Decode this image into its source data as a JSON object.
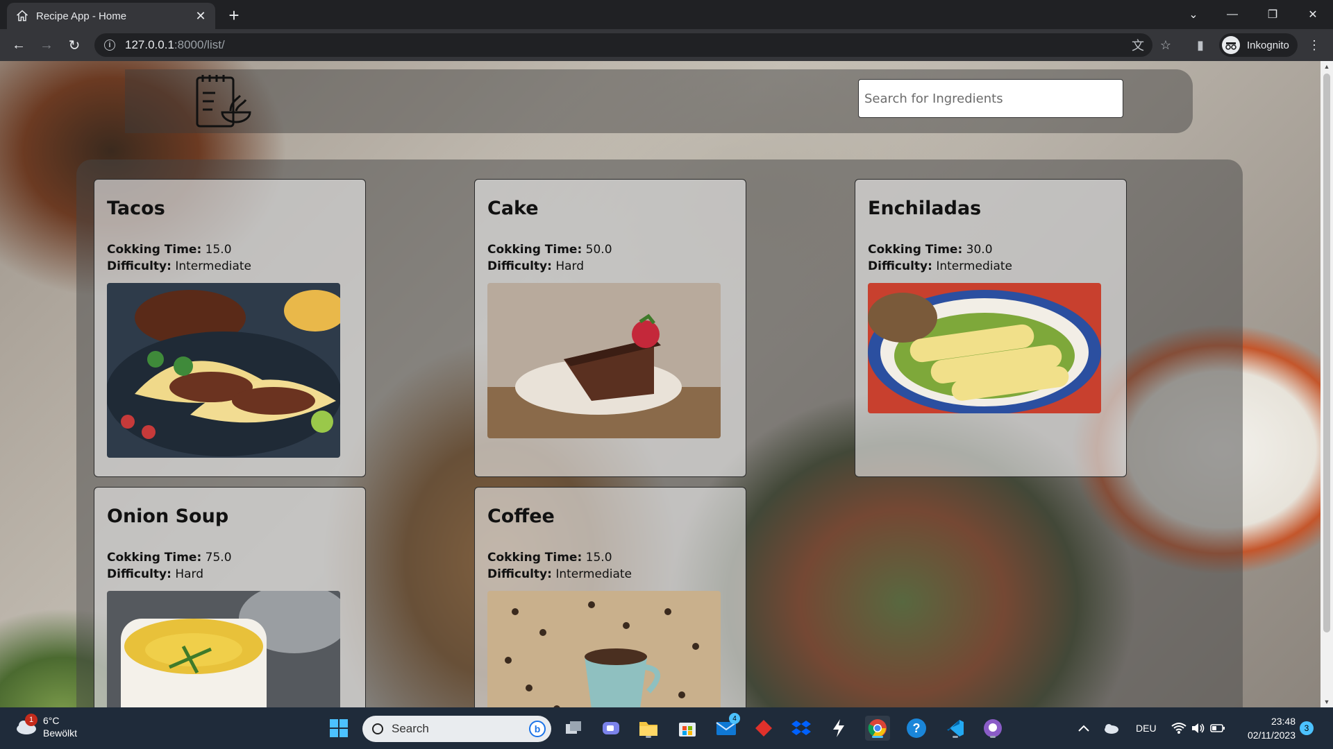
{
  "browser": {
    "tab_title": "Recipe App - Home",
    "url_host": "127.0.0.1",
    "url_path": ":8000/list/",
    "profile_label": "Inkognito"
  },
  "page": {
    "search_placeholder": "Search for Ingredients",
    "cooking_label": "Cokking Time:",
    "difficulty_label": "Difficulty:",
    "recipes": [
      {
        "name": "Tacos",
        "cooking_time": "15.0",
        "difficulty": "Intermediate"
      },
      {
        "name": "Cake",
        "cooking_time": "50.0",
        "difficulty": "Hard"
      },
      {
        "name": "Enchiladas",
        "cooking_time": "30.0",
        "difficulty": "Intermediate"
      },
      {
        "name": "Onion Soup",
        "cooking_time": "75.0",
        "difficulty": "Hard"
      },
      {
        "name": "Coffee",
        "cooking_time": "15.0",
        "difficulty": "Intermediate"
      }
    ]
  },
  "taskbar": {
    "weather_temp": "6°C",
    "weather_desc": "Bewölkt",
    "weather_badge": "1",
    "search_label": "Search",
    "mail_badge": "4",
    "language": "DEU",
    "time": "23:48",
    "date": "02/11/2023",
    "notification_count": "3"
  },
  "colors": {
    "browser_bg": "#202124",
    "toolbar_bg": "#35363a",
    "taskbar_bg": "#1f2b3a",
    "accent": "#4cc2ff"
  }
}
